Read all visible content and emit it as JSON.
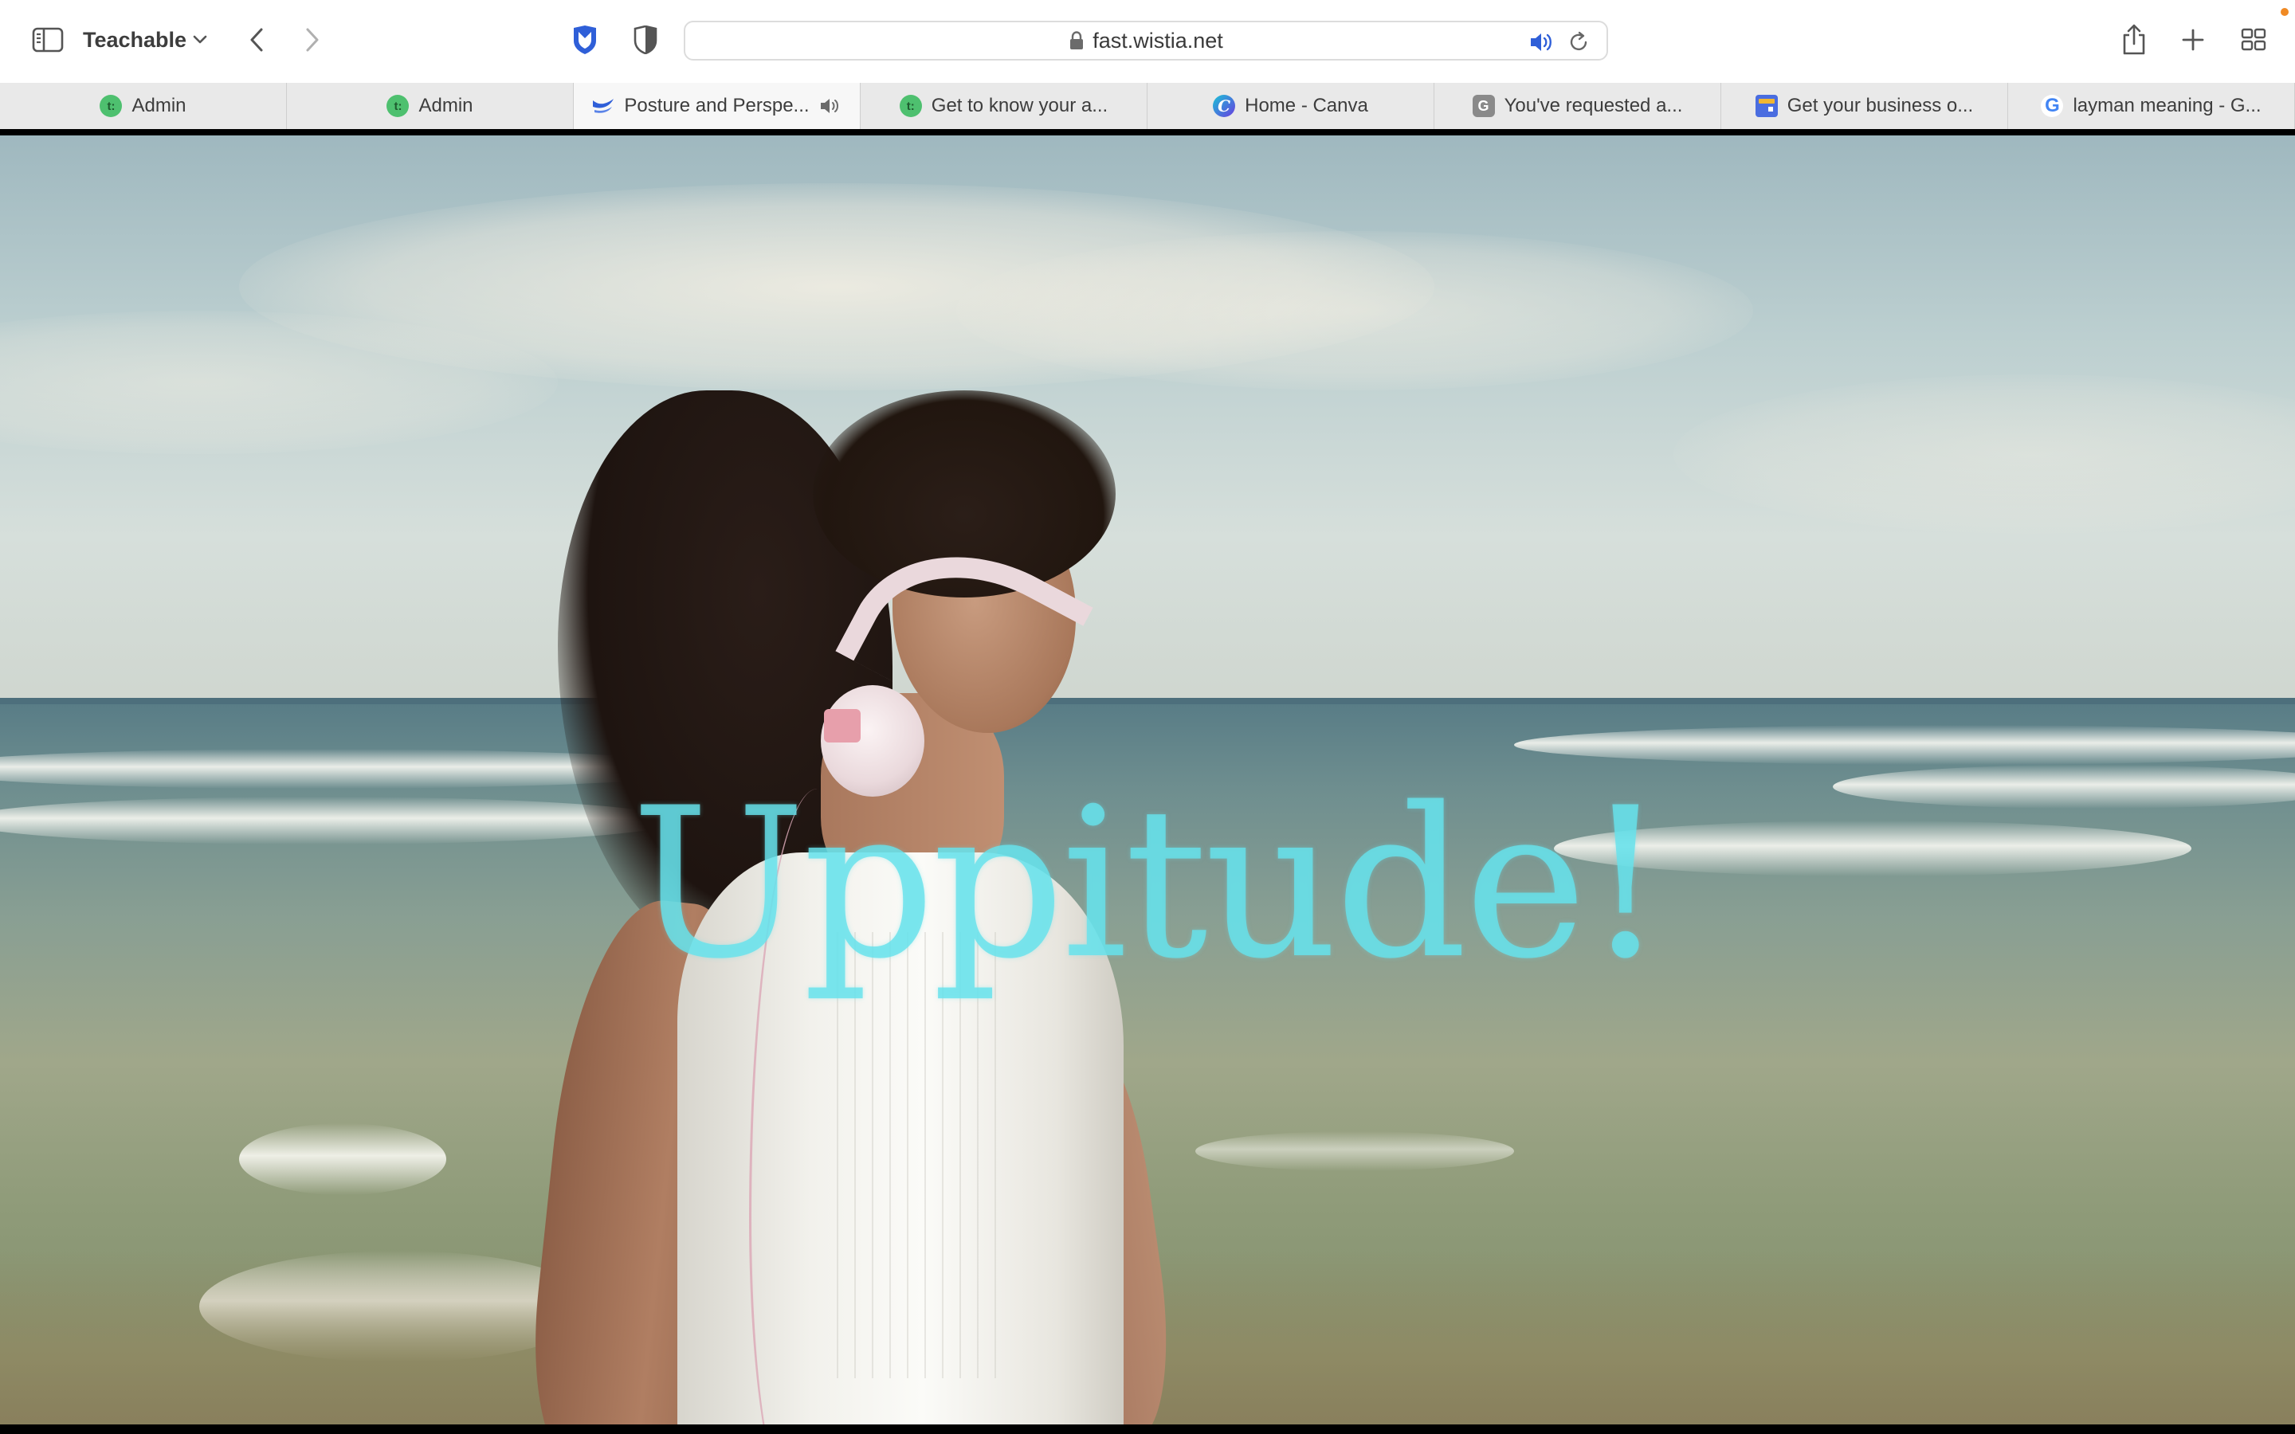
{
  "toolbar": {
    "profile_name": "Teachable",
    "url": "fast.wistia.net"
  },
  "tabs": [
    {
      "label": "Admin",
      "favicon": "teachable-icon",
      "active": false
    },
    {
      "label": "Admin",
      "favicon": "teachable-icon",
      "active": false
    },
    {
      "label": "Posture and Perspe...",
      "favicon": "wistia-icon",
      "active": true,
      "playing_audio": true
    },
    {
      "label": "Get to know your a...",
      "favicon": "teachable-icon",
      "active": false
    },
    {
      "label": "Home - Canva",
      "favicon": "canva-icon",
      "active": false
    },
    {
      "label": "You've requested a...",
      "favicon": "g-letter-icon",
      "active": false
    },
    {
      "label": "Get your business o...",
      "favicon": "business-profile-icon",
      "active": false
    },
    {
      "label": "layman meaning - G...",
      "favicon": "google-icon",
      "active": false
    }
  ],
  "favicon_text": {
    "teachable": "t:",
    "canva": "C",
    "g_letter": "G",
    "google": "G"
  },
  "video": {
    "overlay_text": "Uppitude!",
    "overlay_color": "#66e2ec"
  },
  "colors": {
    "toolbar_bg": "#ffffff",
    "tabbar_bg": "#e9e9e9",
    "active_tab_bg": "#f7f7f7",
    "accent_blue": "#2f5fd8",
    "notification_dot": "#f08a24"
  }
}
